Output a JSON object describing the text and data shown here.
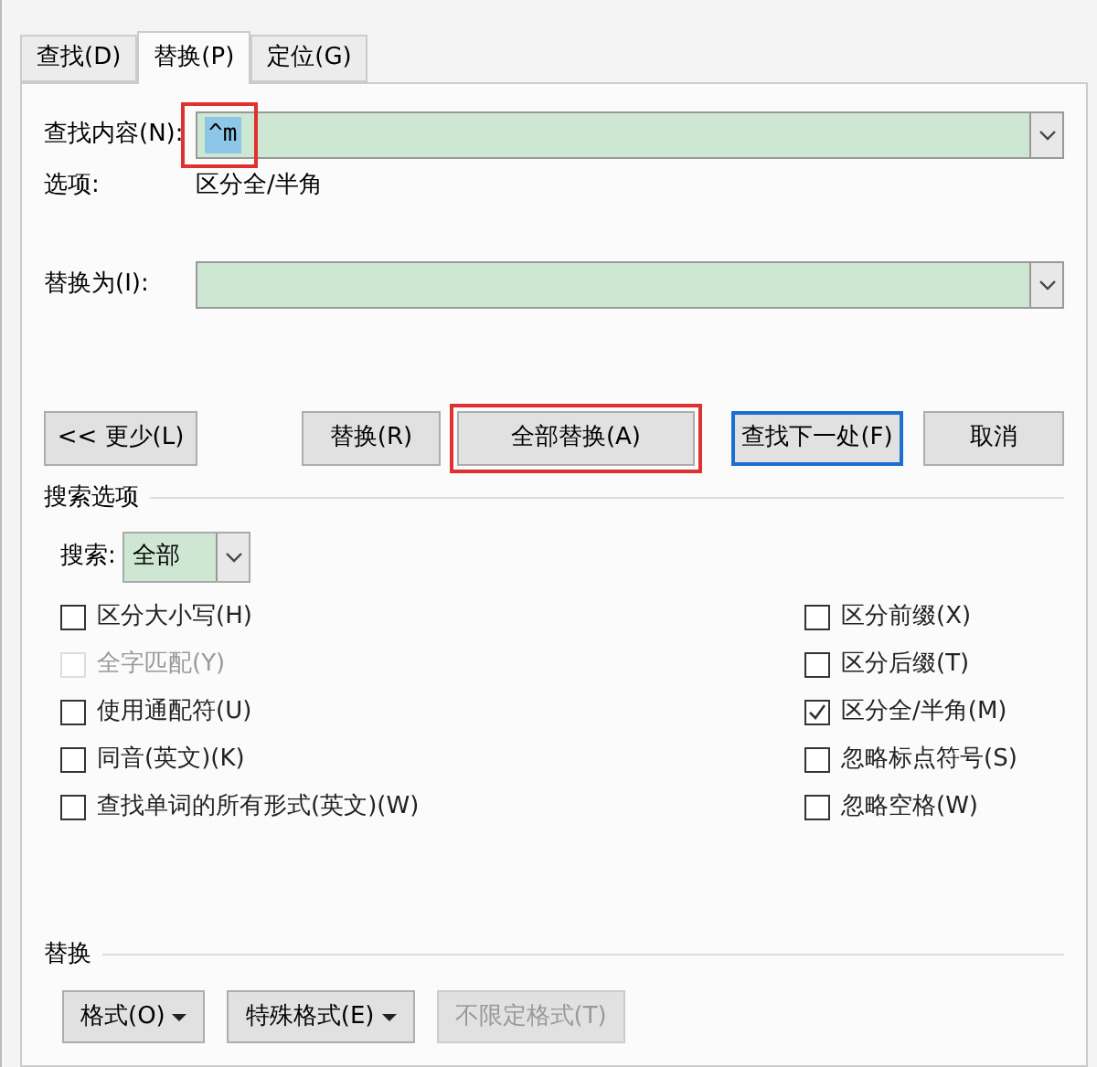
{
  "tabs": [
    {
      "label": "查找(D)",
      "selected": false
    },
    {
      "label": "替换(P)",
      "selected": true
    },
    {
      "label": "定位(G)",
      "selected": false
    }
  ],
  "find": {
    "label": "查找内容(N):",
    "value": "^m",
    "highlighted": true
  },
  "options": {
    "label": "选项:",
    "value": "区分全/半角"
  },
  "replace": {
    "label": "替换为(I):"
  },
  "buttons": [
    {
      "label": "<< 更少(L)",
      "highlighted": false,
      "default": false
    },
    {
      "label": "替换(R)",
      "highlighted": false,
      "default": false
    },
    {
      "label": "全部替换(A)",
      "highlighted": true,
      "default": false
    },
    {
      "label": "查找下一处(F)",
      "highlighted": false,
      "default": true
    },
    {
      "label": "取消",
      "highlighted": false,
      "default": false
    }
  ],
  "search_options": {
    "title": "搜索选项",
    "search_label": "搜索:",
    "search_value": "全部"
  },
  "left_checks": [
    {
      "label": "区分大小写(H)",
      "checked": false,
      "disabled": false
    },
    {
      "label": "全字匹配(Y)",
      "checked": false,
      "disabled": true
    },
    {
      "label": "使用通配符(U)",
      "checked": false,
      "disabled": false
    },
    {
      "label": "同音(英文)(K)",
      "checked": false,
      "disabled": false
    },
    {
      "label": "查找单词的所有形式(英文)(W)",
      "checked": false,
      "disabled": false
    }
  ],
  "right_checks": [
    {
      "label": "区分前缀(X)",
      "checked": false,
      "disabled": false
    },
    {
      "label": "区分后缀(T)",
      "checked": false,
      "disabled": false
    },
    {
      "label": "区分全/半角(M)",
      "checked": true,
      "disabled": false
    },
    {
      "label": "忽略标点符号(S)",
      "checked": false,
      "disabled": false
    },
    {
      "label": "忽略空格(W)",
      "checked": false,
      "disabled": false
    }
  ],
  "replace_section": {
    "title": "替换",
    "buttons": [
      {
        "label": "格式(O)",
        "dropdown": true,
        "disabled": false
      },
      {
        "label": "特殊格式(E)",
        "dropdown": true,
        "disabled": false
      },
      {
        "label": "不限定格式(T)",
        "dropdown": false,
        "disabled": true
      }
    ]
  }
}
